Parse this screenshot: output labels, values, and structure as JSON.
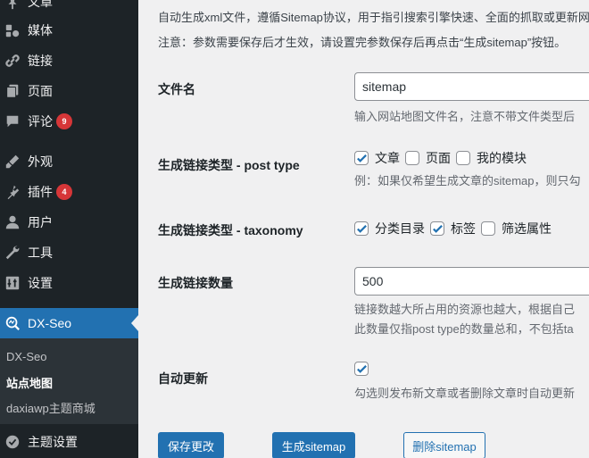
{
  "sidebar": {
    "items": [
      {
        "label": "文章",
        "icon": "pin-icon"
      },
      {
        "label": "媒体",
        "icon": "media-icon"
      },
      {
        "label": "链接",
        "icon": "link-icon"
      },
      {
        "label": "页面",
        "icon": "page-icon"
      },
      {
        "label": "评论",
        "icon": "comment-icon",
        "badge": "9"
      },
      {
        "label": "外观",
        "icon": "appearance-icon"
      },
      {
        "label": "插件",
        "icon": "plugin-icon",
        "badge": "4"
      },
      {
        "label": "用户",
        "icon": "user-icon"
      },
      {
        "label": "工具",
        "icon": "wrench-icon"
      },
      {
        "label": "设置",
        "icon": "settings-icon"
      },
      {
        "label": "DX-Seo",
        "icon": "dxseo-icon"
      },
      {
        "label": "主题设置",
        "icon": "theme-settings-icon"
      }
    ],
    "submenu": [
      "DX-Seo",
      "站点地图",
      "daxiawp主题商城"
    ],
    "active_color": "#2271b1",
    "badge_color": "#d63638"
  },
  "main": {
    "intro_1": "自动生成xml文件，遵循Sitemap协议，用于指引搜索引擎快速、全面的抓取或更新网",
    "intro_2": "注意：参数需要保存后才生效，请设置完参数保存后再点击“生成sitemap”按钮。",
    "filename": {
      "label": "文件名",
      "value": "sitemap",
      "hint": "输入网站地图文件名，注意不带文件类型后"
    },
    "post_type": {
      "label": "生成链接类型 - post type",
      "options": [
        {
          "label": "文章",
          "checked": true
        },
        {
          "label": "页面",
          "checked": false
        },
        {
          "label": "我的模块",
          "checked": false
        }
      ],
      "hint": "例：如果仅希望生成文章的sitemap，则只勾"
    },
    "taxonomy": {
      "label": "生成链接类型 - taxonomy",
      "options": [
        {
          "label": "分类目录",
          "checked": true
        },
        {
          "label": "标签",
          "checked": true
        },
        {
          "label": "筛选属性",
          "checked": false
        }
      ]
    },
    "count": {
      "label": "生成链接数量",
      "value": "500",
      "hint_1": "链接数越大所占用的资源也越大，根据自己",
      "hint_2": "此数量仅指post type的数量总和，不包括ta"
    },
    "auto_update": {
      "label": "自动更新",
      "checked": true,
      "hint": "勾选则发布新文章或者删除文章时自动更新"
    },
    "buttons": {
      "save": "保存更改",
      "generate": "生成sitemap",
      "delete": "删除sitemap"
    }
  }
}
